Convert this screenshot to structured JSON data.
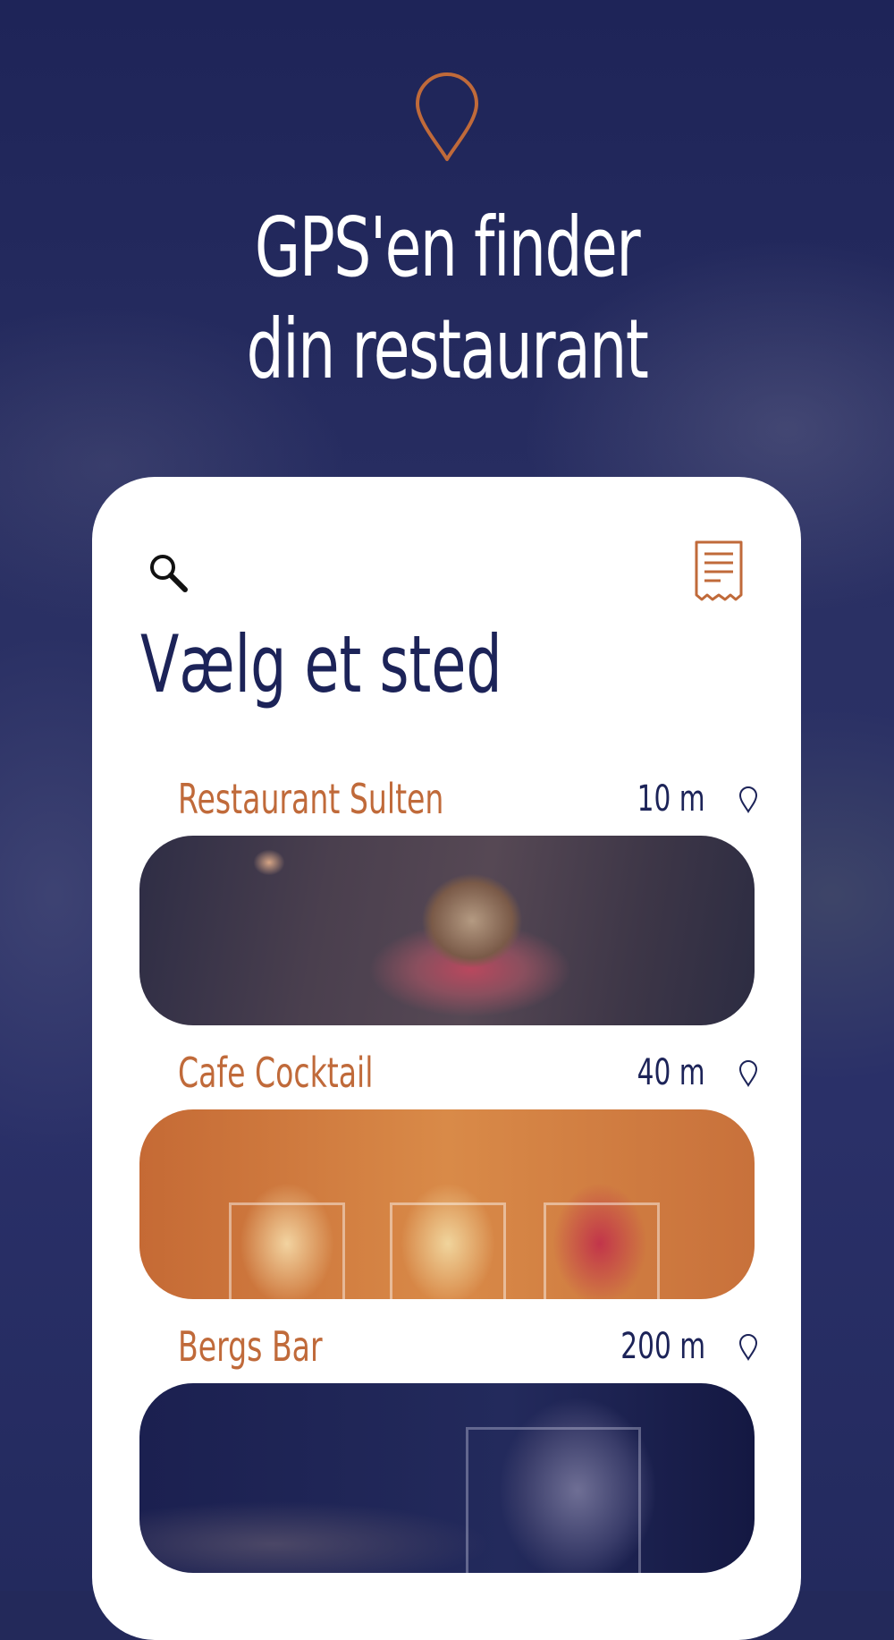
{
  "hero": {
    "title_line1": "GPS'en finder",
    "title_line2": "din restaurant"
  },
  "card": {
    "title": "Vælg et sted"
  },
  "places": [
    {
      "name": "Restaurant Sulten",
      "distance": "10 m"
    },
    {
      "name": "Cafe Cocktail",
      "distance": "40 m"
    },
    {
      "name": "Bergs Bar",
      "distance": "200 m"
    }
  ],
  "icons": {
    "top": "location-pin-icon",
    "search": "search-icon",
    "receipt": "receipt-icon",
    "item": "location-pin-icon"
  },
  "colors": {
    "background": "#23295a",
    "accent": "#c06a3a",
    "title": "#1c2358",
    "card": "#ffffff"
  }
}
